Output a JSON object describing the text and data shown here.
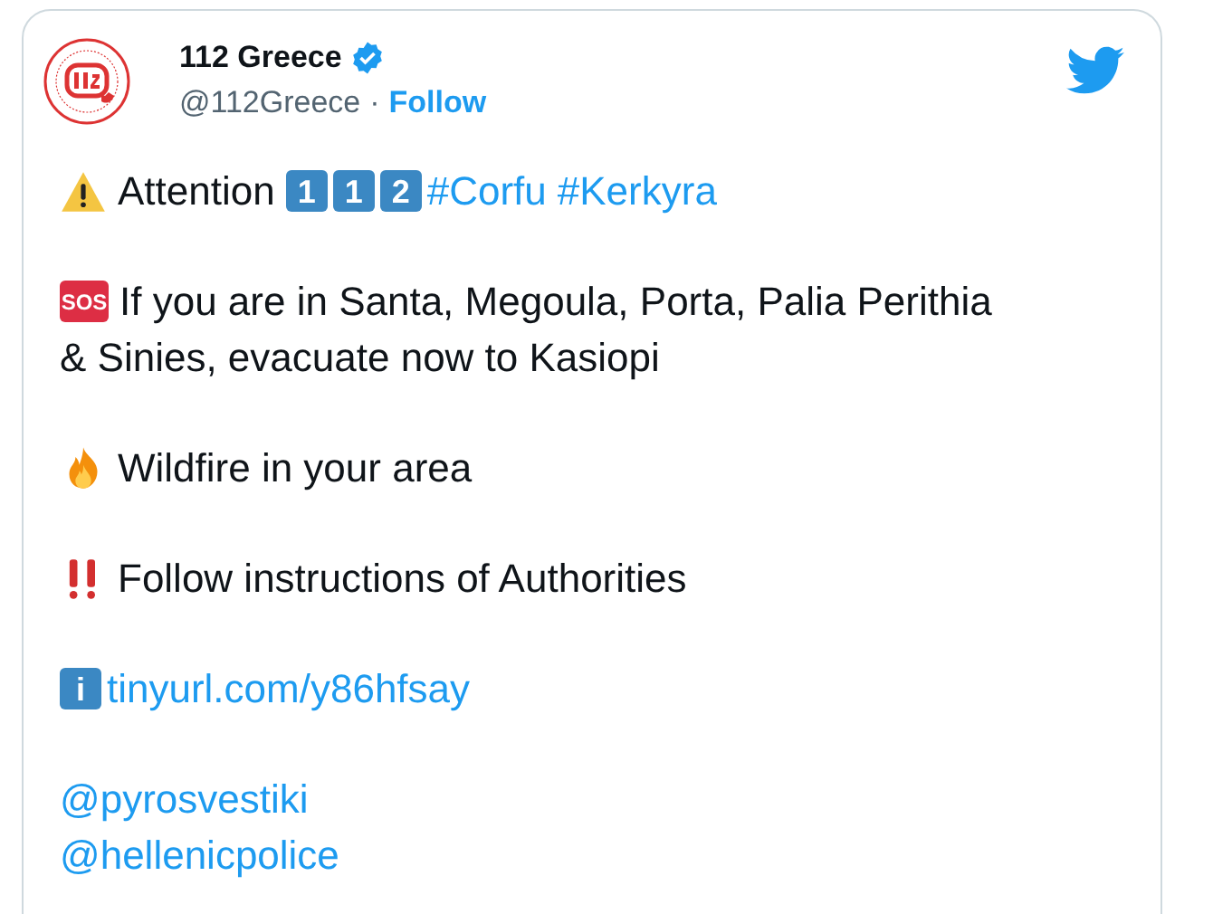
{
  "author": {
    "name": "112 Greece",
    "handle": "@112Greece",
    "separator": "·",
    "follow": "Follow"
  },
  "paragraphs": [
    {
      "lines": [
        [
          {
            "kind": "warning"
          },
          {
            "kind": "text",
            "text": "Attention"
          },
          {
            "kind": "keycap",
            "text": "1"
          },
          {
            "kind": "keycap",
            "text": "1"
          },
          {
            "kind": "keycap",
            "text": "2"
          },
          {
            "kind": "hashtag",
            "text": "#Corfu"
          },
          {
            "kind": "hashtag",
            "text": "#Kerkyra"
          }
        ]
      ]
    },
    {
      "lines": [
        [
          {
            "kind": "sos",
            "text": "SOS"
          },
          {
            "kind": "text",
            "text": "If you are in Santa, Megoula, Porta, Palia Perithia"
          }
        ],
        [
          {
            "kind": "text",
            "text": "& Sinies, evacuate now to Kasiopi"
          }
        ]
      ]
    },
    {
      "lines": [
        [
          {
            "kind": "fire"
          },
          {
            "kind": "text",
            "text": "Wildfire in your area"
          }
        ]
      ]
    },
    {
      "lines": [
        [
          {
            "kind": "bangbang"
          },
          {
            "kind": "text",
            "text": "Follow instructions of Authorities"
          }
        ]
      ]
    },
    {
      "lines": [
        [
          {
            "kind": "keycap",
            "text": "i"
          },
          {
            "kind": "link",
            "text": "tinyurl.com/y86hfsay"
          }
        ]
      ]
    },
    {
      "lines": [
        [
          {
            "kind": "mention",
            "text": "@pyrosvestiki"
          }
        ],
        [
          {
            "kind": "mention",
            "text": "@hellenicpolice"
          }
        ]
      ]
    }
  ]
}
